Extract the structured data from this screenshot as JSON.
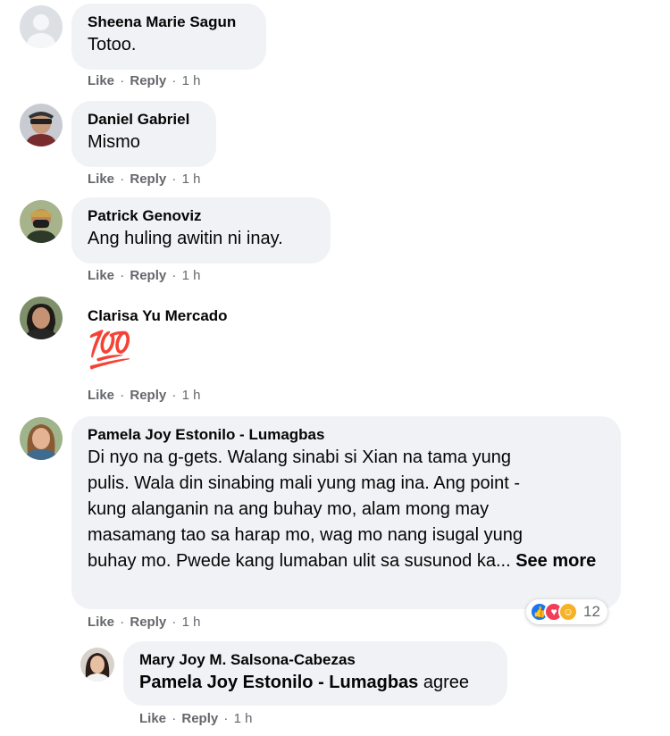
{
  "colors": {
    "bubble": "#f0f2f5",
    "meta_text": "#65676b",
    "like_blue": "#1877f2",
    "love_red": "#f33e58",
    "care_yellow": "#f7b125"
  },
  "comments": [
    {
      "author": "Sheena Marie Sagun",
      "text": "Totoo.",
      "actions": {
        "like": "Like",
        "reply": "Reply",
        "time": "1 h",
        "sep": "·"
      }
    },
    {
      "author": "Daniel Gabriel",
      "text": "Mismo",
      "actions": {
        "like": "Like",
        "reply": "Reply",
        "time": "1 h",
        "sep": "·"
      }
    },
    {
      "author": "Patrick Genoviz",
      "text": "Ang huling awitin ni inay.",
      "actions": {
        "like": "Like",
        "reply": "Reply",
        "time": "1 h",
        "sep": "·"
      }
    },
    {
      "author": "Clarisa Yu Mercado",
      "emoji": "💯",
      "emoji_name": "hundred-points-emoji",
      "actions": {
        "like": "Like",
        "reply": "Reply",
        "time": "1 h",
        "sep": "·"
      }
    },
    {
      "author": "Pamela Joy Estonilo - Lumagbas",
      "lines": [
        "Di nyo na g-gets. Walang sinabi si Xian na tama yung",
        "pulis. Wala din sinabing mali yung mag ina. Ang point -",
        "kung alanganin na ang buhay mo, alam mong may",
        "masamang tao sa harap mo, wag mo nang isugal yung",
        "buhay mo. Pwede kang lumaban ulit sa susunod ka..."
      ],
      "see_more": "See more",
      "reactions": {
        "icons": [
          "like-reaction-icon",
          "love-reaction-icon",
          "care-reaction-icon"
        ],
        "count": "12"
      },
      "actions": {
        "like": "Like",
        "reply": "Reply",
        "time": "1 h",
        "sep": "·"
      }
    }
  ],
  "reply": {
    "author": "Mary Joy M. Salsona-Cabezas",
    "mention": "Pamela Joy Estonilo - Lumagbas",
    "text": " agree",
    "actions": {
      "like": "Like",
      "reply": "Reply",
      "time": "1 h",
      "sep": "·"
    }
  }
}
